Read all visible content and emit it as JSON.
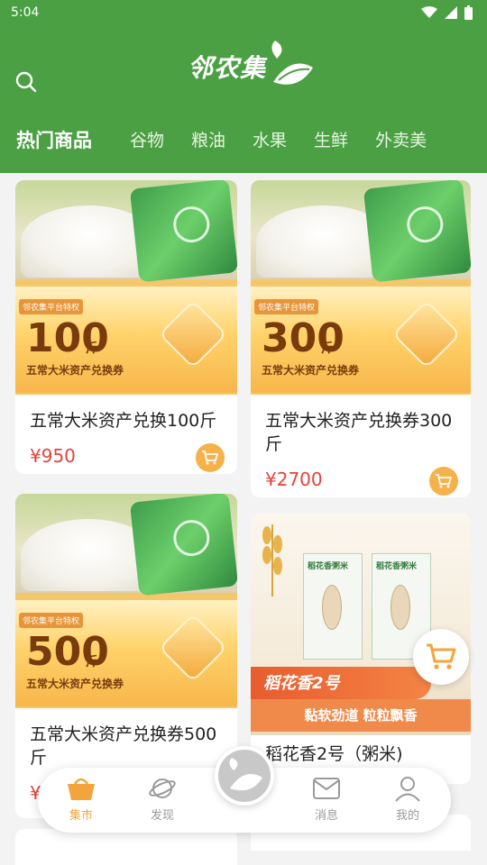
{
  "status_bar": {
    "time": "5:04"
  },
  "header": {
    "logo_text": "邻农集"
  },
  "tabs": [
    {
      "label": "热门商品"
    },
    {
      "label": "谷物"
    },
    {
      "label": "粮油"
    },
    {
      "label": "水果"
    },
    {
      "label": "生鲜"
    },
    {
      "label": "外卖美"
    }
  ],
  "products": [
    {
      "title": "五常大米资产兑换100斤",
      "price": "¥950",
      "voucher_amount": "100",
      "voucher_unit": "斤",
      "voucher_badge": "邻农集平台特权",
      "voucher_sub": "五常大米资产兑换券"
    },
    {
      "title": "五常大米资产兑换券300斤",
      "price": "¥2700",
      "voucher_amount": "300",
      "voucher_unit": "斤",
      "voucher_badge": "邻农集平台特权",
      "voucher_sub": "五常大米资产兑换券"
    },
    {
      "title": "五常大米资产兑换券500斤",
      "price": "¥",
      "voucher_amount": "500",
      "voucher_unit": "斤",
      "voucher_badge": "邻农集平台特权",
      "voucher_sub": "五常大米资产兑换券"
    },
    {
      "title": "稻花香2号（粥米)",
      "box_label": "稻花香粥米",
      "ribbon": "稻花香2号",
      "ribbon_sub": "黏软劲道 粒粒飘香"
    }
  ],
  "bottom_nav": [
    {
      "label": "集市",
      "icon": "basket-icon",
      "active": true
    },
    {
      "label": "发现",
      "icon": "planet-icon",
      "active": false
    },
    {
      "label": "消息",
      "icon": "mail-icon",
      "active": false
    },
    {
      "label": "我的",
      "icon": "user-icon",
      "active": false
    }
  ],
  "colors": {
    "brand_green": "#4aa043",
    "price_red": "#e6423a",
    "accent_orange": "#f3a53b"
  }
}
